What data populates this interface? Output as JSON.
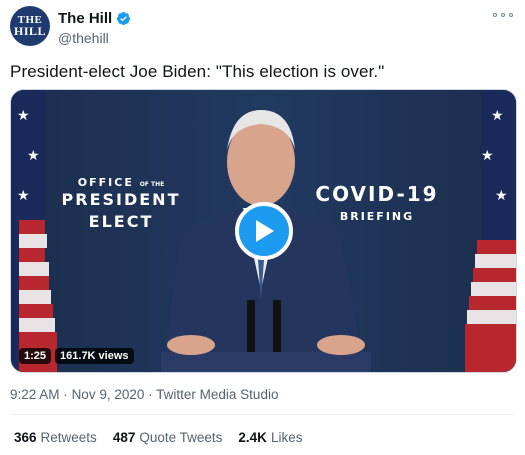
{
  "author": {
    "avatar_line1": "THE",
    "avatar_line2": "HILL",
    "display_name": "The Hill",
    "handle": "@thehill",
    "verified_icon": "verified-badge-icon",
    "more_icon": "more-options-icon"
  },
  "tweet": {
    "text": "President-elect Joe Biden: \"This election is over.\""
  },
  "video": {
    "sign_left_office": "OFFICE",
    "sign_left_of_the": "OF THE",
    "sign_left_line1": "PRESIDENT",
    "sign_left_line2": "ELECT",
    "sign_right_line1": "COVID-19",
    "sign_right_line2": "BRIEFING",
    "duration": "1:25",
    "views": "161.7K views",
    "play_icon": "play-icon"
  },
  "meta": {
    "time": "9:22 AM",
    "date": "Nov 9, 2020",
    "source": "Twitter Media Studio",
    "separator": "·"
  },
  "stats": [
    {
      "count": "366",
      "label": "Retweets"
    },
    {
      "count": "487",
      "label": "Quote Tweets"
    },
    {
      "count": "2.4K",
      "label": "Likes"
    }
  ],
  "colors": {
    "accent": "#1d9bf0",
    "text": "#0f1419",
    "secondary": "#536471",
    "avatar_bg": "#1f3a6e"
  }
}
